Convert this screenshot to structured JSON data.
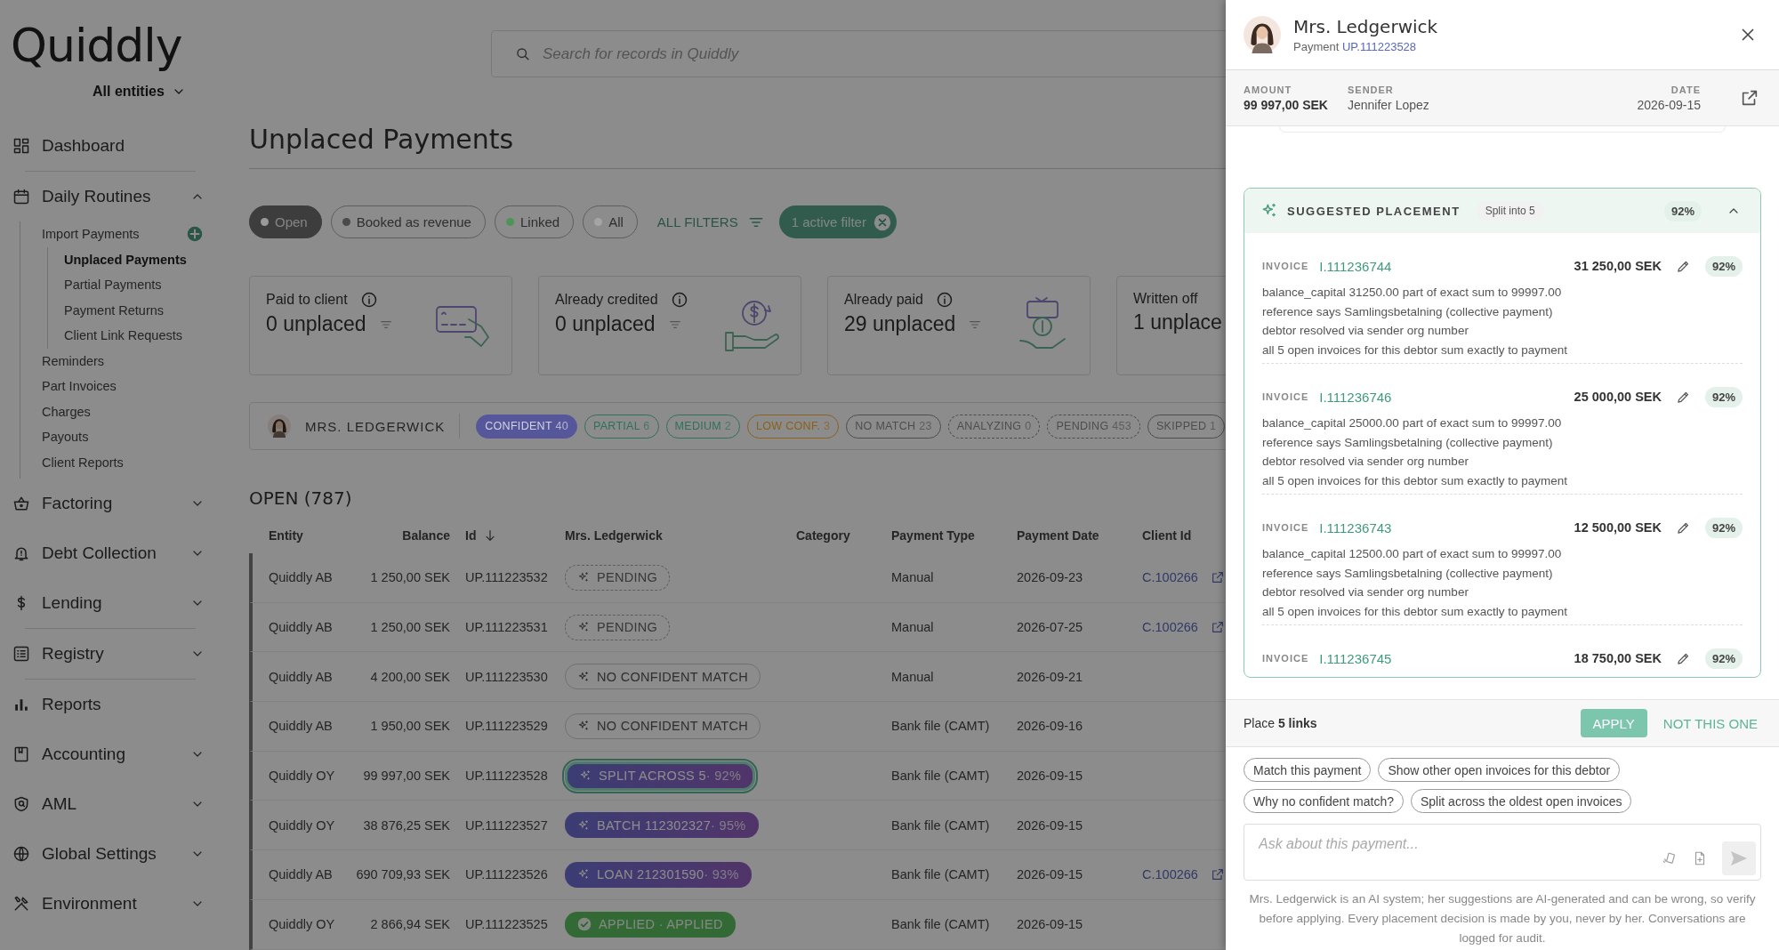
{
  "app": {
    "logo": "Quiddly",
    "entity_selector": "All entities"
  },
  "sidebar": {
    "items": [
      {
        "label": "Dashboard",
        "divider": true
      },
      {
        "label": "Daily Routines",
        "expanded": true,
        "divider": false,
        "children": [
          {
            "label": "Import Payments",
            "selected": false,
            "add_button": true,
            "children": [
              {
                "label": "Unplaced Payments",
                "selected": true
              },
              {
                "label": "Partial Payments",
                "selected": false
              },
              {
                "label": "Payment Returns",
                "selected": false
              },
              {
                "label": "Client Link Requests",
                "selected": false
              }
            ]
          },
          {
            "label": "Reminders",
            "selected": false
          },
          {
            "label": "Part Invoices",
            "selected": false
          },
          {
            "label": "Charges",
            "selected": false
          },
          {
            "label": "Payouts",
            "selected": false
          },
          {
            "label": "Client Reports",
            "selected": false
          }
        ]
      },
      {
        "label": "Factoring",
        "expanded": false,
        "divider": false
      },
      {
        "label": "Debt Collection",
        "expanded": false,
        "divider": false
      },
      {
        "label": "Lending",
        "expanded": false,
        "divider": true
      },
      {
        "label": "Registry",
        "expanded": false,
        "divider": true
      },
      {
        "label": "Reports",
        "divider": false
      },
      {
        "label": "Accounting",
        "expanded": false,
        "divider": false
      },
      {
        "label": "AML",
        "expanded": false,
        "divider": false
      },
      {
        "label": "Global Settings",
        "expanded": false,
        "divider": false
      },
      {
        "label": "Environment",
        "expanded": false,
        "divider": false
      }
    ]
  },
  "search": {
    "placeholder": "Search for records in Quiddly"
  },
  "page_title": "Unplaced Payments",
  "status_filters": [
    {
      "label": "Open",
      "color": "#9a9a9a",
      "selected": true
    },
    {
      "label": "Booked as revenue",
      "color": "#4a4a4a",
      "selected": false
    },
    {
      "label": "Linked",
      "color": "#4f9457",
      "selected": false
    },
    {
      "label": "All",
      "color": "#a5a5a5",
      "selected": false
    }
  ],
  "all_filters": "ALL FILTERS",
  "active_filter": "1 active filter",
  "summary_cards": [
    {
      "label": "Paid to client",
      "value": "0 unplaced",
      "info": true
    },
    {
      "label": "Already credited",
      "value": "0 unplaced",
      "info": true
    },
    {
      "label": "Already paid",
      "value": "29 unplaced",
      "info": true
    },
    {
      "label": "Written off",
      "value": "1 unplace",
      "info": false
    }
  ],
  "agent_bar": {
    "name": "MRS. LEDGERWICK",
    "chips": [
      {
        "label": "CONFIDENT",
        "count": "40",
        "kind": "filled",
        "color": "#55579a"
      },
      {
        "label": "PARTIAL",
        "count": "6",
        "kind": "outline",
        "color": "#2f705b"
      },
      {
        "label": "MEDIUM",
        "count": "2",
        "kind": "outline",
        "color": "#2f705b"
      },
      {
        "label": "LOW CONF.",
        "count": "3",
        "kind": "outline",
        "color": "#8a6218"
      },
      {
        "label": "NO MATCH",
        "count": "23",
        "kind": "outline",
        "color": "#4d4d4d"
      },
      {
        "label": "ANALYZING",
        "count": "0",
        "kind": "dashed",
        "color": "#4d4d4d"
      },
      {
        "label": "PENDING",
        "count": "453",
        "kind": "dashed",
        "color": "#4d4d4d"
      },
      {
        "label": "SKIPPED",
        "count": "1",
        "kind": "outline",
        "color": "#4d4d4d"
      }
    ]
  },
  "table": {
    "title": "OPEN (787)",
    "columns": [
      {
        "label": "Entity",
        "sorted": false
      },
      {
        "label": "Balance",
        "sorted": false
      },
      {
        "label": "Id",
        "sorted": true
      },
      {
        "label": "Mrs. Ledgerwick",
        "sorted": false
      },
      {
        "label": "Category",
        "sorted": false
      },
      {
        "label": "Payment Type",
        "sorted": false
      },
      {
        "label": "Payment Date",
        "sorted": false
      },
      {
        "label": "Client Id",
        "sorted": false
      }
    ],
    "rows": [
      {
        "entity": "Quiddly AB",
        "balance": "1 250,00 SEK",
        "id": "UP.111223532",
        "agent": {
          "kind": "pending",
          "label": "PENDING"
        },
        "payment_type": "Manual",
        "payment_date": "2026-09-23",
        "client_id": "C.100266",
        "selected": false
      },
      {
        "entity": "Quiddly AB",
        "balance": "1 250,00 SEK",
        "id": "UP.111223531",
        "agent": {
          "kind": "pending",
          "label": "PENDING"
        },
        "payment_type": "Manual",
        "payment_date": "2026-07-25",
        "client_id": "C.100266",
        "selected": false
      },
      {
        "entity": "Quiddly AB",
        "balance": "4 200,00 SEK",
        "id": "UP.111223530",
        "agent": {
          "kind": "none",
          "label": "NO CONFIDENT MATCH"
        },
        "payment_type": "Manual",
        "payment_date": "2026-09-21",
        "selected": false
      },
      {
        "entity": "Quiddly AB",
        "balance": "1 950,00 SEK",
        "id": "UP.111223529",
        "agent": {
          "kind": "none",
          "label": "NO CONFIDENT MATCH"
        },
        "payment_type": "Bank file (CAMT)",
        "payment_date": "2026-09-16",
        "selected": false
      },
      {
        "entity": "Quiddly OY",
        "balance": "99 997,00 SEK",
        "id": "UP.111223528",
        "agent": {
          "kind": "suggestion",
          "label": "SPLIT ACROSS 5",
          "score": "· 92%"
        },
        "payment_type": "Bank file (CAMT)",
        "payment_date": "2026-09-15",
        "selected": true
      },
      {
        "entity": "Quiddly OY",
        "balance": "38 876,25 SEK",
        "id": "UP.111223527",
        "agent": {
          "kind": "suggestion",
          "label": "BATCH 112302327",
          "score": "· 95%"
        },
        "payment_type": "Bank file (CAMT)",
        "payment_date": "2026-09-15",
        "selected": false
      },
      {
        "entity": "Quiddly AB",
        "balance": "690 709,93 SEK",
        "id": "UP.111223526",
        "agent": {
          "kind": "suggestion",
          "label": "LOAN 212301590",
          "score": "· 93%"
        },
        "payment_type": "Bank file (CAMT)",
        "payment_date": "2026-09-15",
        "client_id": "C.100266",
        "selected": false
      },
      {
        "entity": "Quiddly OY",
        "balance": "2 866,94 SEK",
        "id": "UP.111223525",
        "agent": {
          "kind": "applied",
          "label": "APPLIED · APPLIED"
        },
        "payment_type": "Bank file (CAMT)",
        "payment_date": "2026-09-15",
        "selected": false
      }
    ]
  },
  "drawer": {
    "name": "Mrs. Ledgerwick",
    "subtitle": "Payment",
    "payment_link": "UP.111223528",
    "info": [
      {
        "label": "AMOUNT",
        "value": "99 997,00 SEK"
      },
      {
        "label": "SENDER",
        "value": "Jennifer Lopez"
      },
      {
        "label": "DATE",
        "value": "2026-09-15"
      }
    ],
    "placement": {
      "title": "SUGGESTED PLACEMENT",
      "tag": "Split into 5",
      "score": "92%",
      "expanded": true,
      "invoices": [
        {
          "label": "INVOICE",
          "id": "I.111236744",
          "amount": "31 250,00 SEK",
          "score": "92%",
          "reasons": [
            "balance_capital 31250.00 part of exact sum to 99997.00",
            "reference says Samlingsbetalning (collective payment)",
            "debtor resolved via sender org number",
            "all 5 open invoices for this debtor sum exactly to payment"
          ]
        },
        {
          "label": "INVOICE",
          "id": "I.111236746",
          "amount": "25 000,00 SEK",
          "score": "92%",
          "reasons": [
            "balance_capital 25000.00 part of exact sum to 99997.00",
            "reference says Samlingsbetalning (collective payment)",
            "debtor resolved via sender org number",
            "all 5 open invoices for this debtor sum exactly to payment"
          ]
        },
        {
          "label": "INVOICE",
          "id": "I.111236743",
          "amount": "12 500,00 SEK",
          "score": "92%",
          "reasons": [
            "balance_capital 12500.00 part of exact sum to 99997.00",
            "reference says Samlingsbetalning (collective payment)",
            "debtor resolved via sender org number",
            "all 5 open invoices for this debtor sum exactly to payment"
          ]
        },
        {
          "label": "INVOICE",
          "id": "I.111236745",
          "amount": "18 750,00 SEK",
          "score": "92%"
        }
      ]
    },
    "action": {
      "text": "Place **5 links**",
      "apply": "APPLY",
      "reject": "NOT THIS ONE"
    },
    "suggestions": [
      "Match this payment",
      "Show other open invoices for this debtor",
      "Why no confident match?",
      "Split across the oldest open invoices"
    ],
    "input": {
      "placeholder": "Ask about this payment..."
    },
    "disclaimer": "Mrs. Ledgerwick is an AI system; her suggestions are AI-generated and can be wrong, so verify before applying. Every placement decision is made by you, never by her. Conversations are logged for audit."
  }
}
